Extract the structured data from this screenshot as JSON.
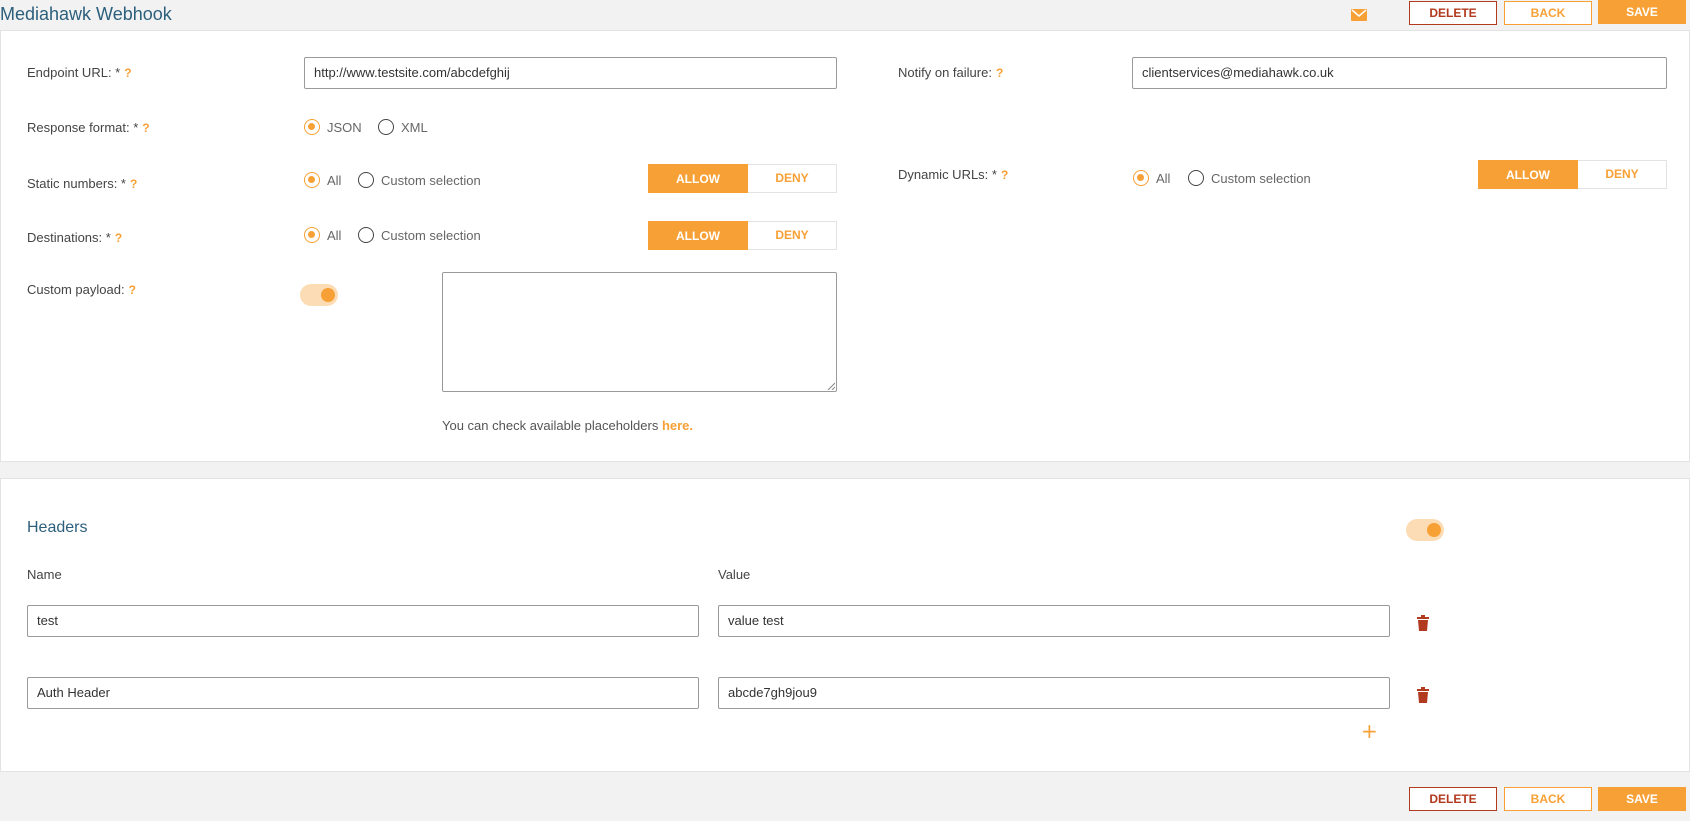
{
  "page": {
    "title": "Mediahawk Webhook",
    "icons": {
      "mail": "mail-icon",
      "trash": "trash-icon",
      "add": "plus-icon"
    }
  },
  "actions": {
    "delete_label": "DELETE",
    "back_label": "BACK",
    "save_label": "SAVE"
  },
  "form": {
    "endpoint": {
      "label": "Endpoint URL: *",
      "help": "?",
      "value": "http://www.testsite.com/abcdefghij"
    },
    "notify": {
      "label": "Notify on failure:",
      "help": "?",
      "value": "clientservices@mediahawk.co.uk"
    },
    "response_format": {
      "label": "Response format: *",
      "help": "?",
      "options": [
        "JSON",
        "XML"
      ],
      "selected": "JSON"
    },
    "static_numbers": {
      "label": "Static numbers: *",
      "help": "?",
      "options": [
        "All",
        "Custom selection"
      ],
      "selected": "All",
      "allow": "ALLOW",
      "deny": "DENY",
      "mode": "ALLOW"
    },
    "dynamic_urls": {
      "label": "Dynamic URLs: *",
      "help": "?",
      "options": [
        "All",
        "Custom selection"
      ],
      "selected": "All",
      "allow": "ALLOW",
      "deny": "DENY",
      "mode": "ALLOW"
    },
    "destinations": {
      "label": "Destinations: *",
      "help": "?",
      "options": [
        "All",
        "Custom selection"
      ],
      "selected": "All",
      "allow": "ALLOW",
      "deny": "DENY",
      "mode": "ALLOW"
    },
    "custom_payload": {
      "label": "Custom payload:",
      "help": "?",
      "enabled": true,
      "value": "",
      "helper_text": "You can check available placeholders ",
      "helper_link": "here."
    }
  },
  "headers": {
    "title": "Headers",
    "enabled": true,
    "name_label": "Name",
    "value_label": "Value",
    "rows": [
      {
        "name": "test",
        "value": "value test"
      },
      {
        "name": "Auth Header",
        "value": "abcde7gh9jou9"
      }
    ]
  },
  "colors": {
    "accent": "#f7a035",
    "danger": "#b23a1e",
    "title": "#2c5f7c"
  }
}
